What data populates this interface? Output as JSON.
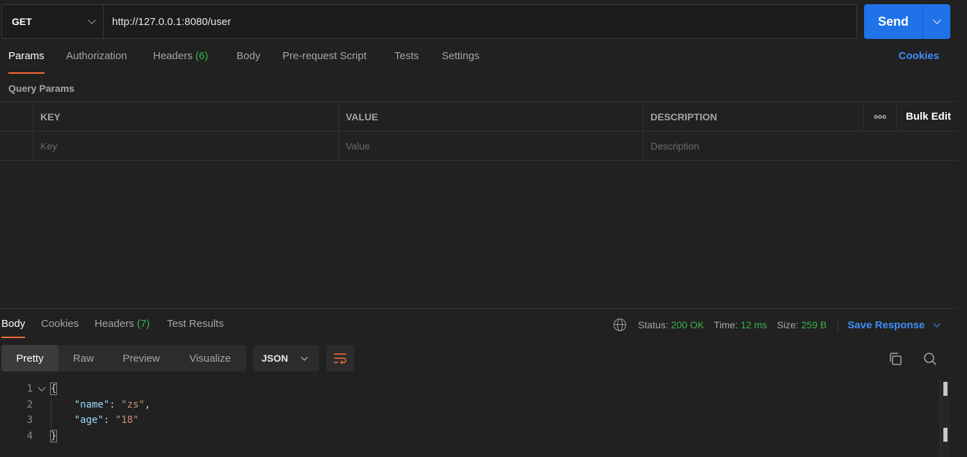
{
  "request": {
    "method": "GET",
    "url": "http://127.0.0.1:8080/user",
    "send_label": "Send"
  },
  "request_tabs": [
    {
      "label": "Params",
      "active": true
    },
    {
      "label": "Authorization"
    },
    {
      "label": "Headers",
      "count": "(6)"
    },
    {
      "label": "Body"
    },
    {
      "label": "Pre-request Script"
    },
    {
      "label": "Tests"
    },
    {
      "label": "Settings"
    }
  ],
  "cookies_label": "Cookies",
  "query_params": {
    "title": "Query Params",
    "columns": {
      "key": "KEY",
      "value": "VALUE",
      "description": "DESCRIPTION"
    },
    "more_label": "ooo",
    "bulk_edit_label": "Bulk Edit",
    "placeholders": {
      "key": "Key",
      "value": "Value",
      "description": "Description"
    }
  },
  "response_tabs": [
    {
      "label": "Body",
      "active": true
    },
    {
      "label": "Cookies"
    },
    {
      "label": "Headers",
      "count": "(7)"
    },
    {
      "label": "Test Results"
    }
  ],
  "response_meta": {
    "status_label": "Status:",
    "status_value": "200 OK",
    "time_label": "Time:",
    "time_value": "12 ms",
    "size_label": "Size:",
    "size_value": "259 B",
    "save_label": "Save Response"
  },
  "view_modes": [
    {
      "label": "Pretty",
      "active": true
    },
    {
      "label": "Raw"
    },
    {
      "label": "Preview"
    },
    {
      "label": "Visualize"
    }
  ],
  "format": "JSON",
  "code": {
    "line_numbers": [
      "1",
      "2",
      "3",
      "4"
    ],
    "open_brace": "{",
    "close_brace": "}",
    "lines": [
      {
        "key": "\"name\"",
        "colon": ": ",
        "value": "\"zs\"",
        "trail": ","
      },
      {
        "key": "\"age\"",
        "colon": ": ",
        "value": "\"18\"",
        "trail": ""
      }
    ]
  },
  "colors": {
    "accent_orange": "#ff6c37",
    "send_blue": "#1f72e8",
    "link_blue": "#3e8ef7",
    "success_green": "#39b54a"
  },
  "icons": [
    "chevron-down-icon",
    "globe-icon",
    "wrap-lines-icon",
    "copy-icon",
    "search-icon"
  ]
}
